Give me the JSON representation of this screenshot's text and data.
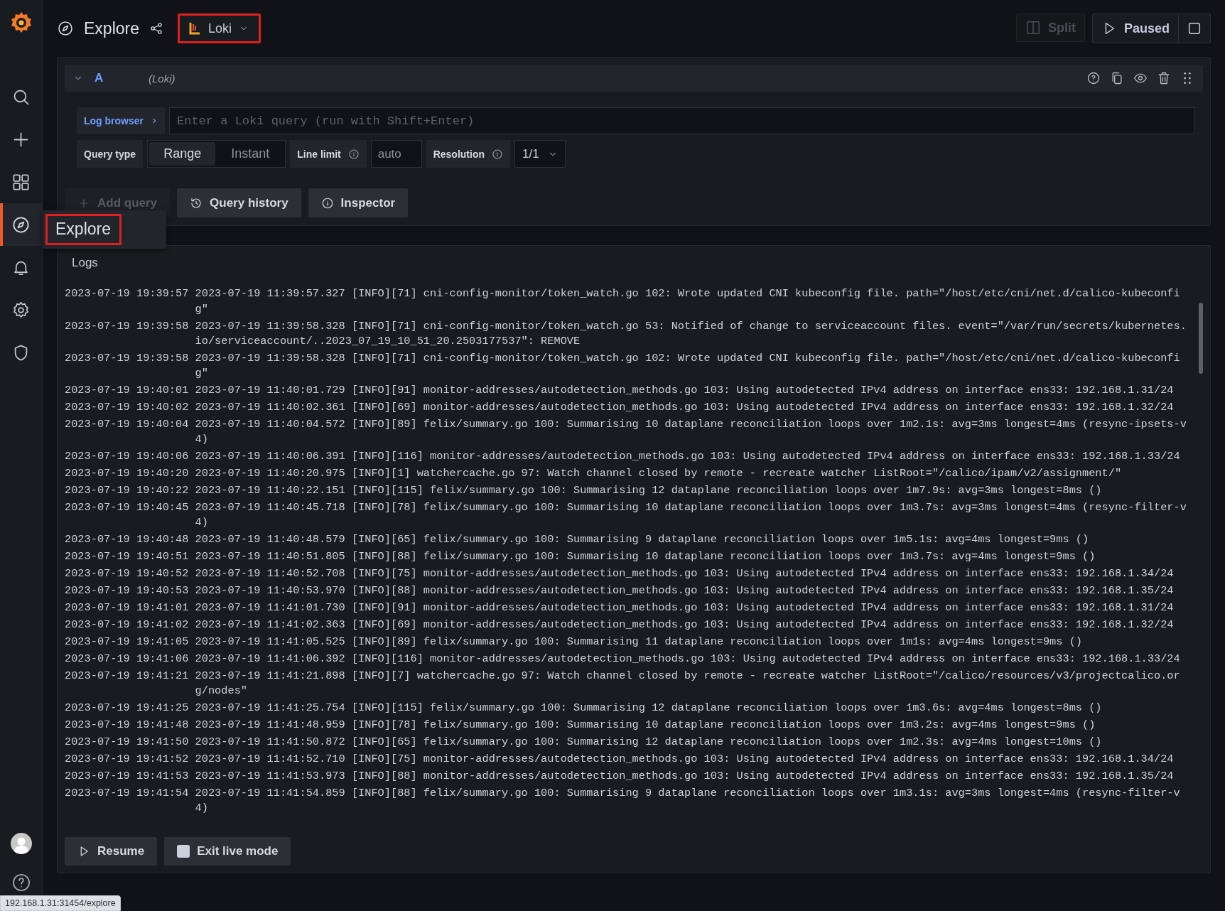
{
  "sidebar": {
    "items": [
      {
        "kind": "search",
        "selected": false
      },
      {
        "kind": "create",
        "selected": false
      },
      {
        "kind": "dashboards",
        "selected": false
      },
      {
        "kind": "explore",
        "selected": true
      },
      {
        "kind": "alerting",
        "selected": false
      },
      {
        "kind": "configuration",
        "selected": false
      },
      {
        "kind": "admin",
        "selected": false
      }
    ],
    "tooltip": "Explore"
  },
  "header": {
    "title": "Explore",
    "datasource": "Loki",
    "split": "Split",
    "live": "Paused"
  },
  "query": {
    "ref": "A",
    "datasource": "(Loki)",
    "log_browser": "Log browser",
    "placeholder": "Enter a Loki query (run with Shift+Enter)",
    "query_type_label": "Query type",
    "query_types": [
      {
        "label": "Range",
        "selected": true
      },
      {
        "label": "Instant",
        "selected": false
      }
    ],
    "line_limit_label": "Line limit",
    "line_limit_placeholder": "auto",
    "resolution_label": "Resolution",
    "resolution": "1/1"
  },
  "actions": [
    {
      "kind": "add",
      "label": "Add query",
      "disabled": true
    },
    {
      "kind": "history",
      "label": "Query history",
      "disabled": false
    },
    {
      "kind": "inspector",
      "label": "Inspector",
      "disabled": false
    }
  ],
  "logs": {
    "title": "Logs",
    "rows": [
      {
        "time": "2023-07-19 19:39:57",
        "line": "2023-07-19 11:39:57.327 [INFO][71] cni-config-monitor/token_watch.go 102: Wrote updated CNI kubeconfig file. path=\"/host/etc/cni/net.d/calico-kubeconfig\""
      },
      {
        "time": "2023-07-19 19:39:58",
        "line": "2023-07-19 11:39:58.328 [INFO][71] cni-config-monitor/token_watch.go 53: Notified of change to serviceaccount files. event=\"/var/run/secrets/kubernetes.io/serviceaccount/..2023_07_19_10_51_20.2503177537\": REMOVE"
      },
      {
        "time": "2023-07-19 19:39:58",
        "line": "2023-07-19 11:39:58.328 [INFO][71] cni-config-monitor/token_watch.go 102: Wrote updated CNI kubeconfig file. path=\"/host/etc/cni/net.d/calico-kubeconfig\""
      },
      {
        "time": "2023-07-19 19:40:01",
        "line": "2023-07-19 11:40:01.729 [INFO][91] monitor-addresses/autodetection_methods.go 103: Using autodetected IPv4 address on interface ens33: 192.168.1.31/24"
      },
      {
        "time": "2023-07-19 19:40:02",
        "line": "2023-07-19 11:40:02.361 [INFO][69] monitor-addresses/autodetection_methods.go 103: Using autodetected IPv4 address on interface ens33: 192.168.1.32/24"
      },
      {
        "time": "2023-07-19 19:40:04",
        "line": "2023-07-19 11:40:04.572 [INFO][89] felix/summary.go 100: Summarising 10 dataplane reconciliation loops over 1m2.1s: avg=3ms longest=4ms (resync-ipsets-v4)"
      },
      {
        "time": "2023-07-19 19:40:06",
        "line": "2023-07-19 11:40:06.391 [INFO][116] monitor-addresses/autodetection_methods.go 103: Using autodetected IPv4 address on interface ens33: 192.168.1.33/24"
      },
      {
        "time": "2023-07-19 19:40:20",
        "line": "2023-07-19 11:40:20.975 [INFO][1] watchercache.go 97: Watch channel closed by remote - recreate watcher ListRoot=\"/calico/ipam/v2/assignment/\""
      },
      {
        "time": "2023-07-19 19:40:22",
        "line": "2023-07-19 11:40:22.151 [INFO][115] felix/summary.go 100: Summarising 12 dataplane reconciliation loops over 1m7.9s: avg=3ms longest=8ms ()"
      },
      {
        "time": "2023-07-19 19:40:45",
        "line": "2023-07-19 11:40:45.718 [INFO][78] felix/summary.go 100: Summarising 10 dataplane reconciliation loops over 1m3.7s: avg=3ms longest=4ms (resync-filter-v4)"
      },
      {
        "time": "2023-07-19 19:40:48",
        "line": "2023-07-19 11:40:48.579 [INFO][65] felix/summary.go 100: Summarising 9 dataplane reconciliation loops over 1m5.1s: avg=4ms longest=9ms ()"
      },
      {
        "time": "2023-07-19 19:40:51",
        "line": "2023-07-19 11:40:51.805 [INFO][88] felix/summary.go 100: Summarising 10 dataplane reconciliation loops over 1m3.7s: avg=4ms longest=9ms ()"
      },
      {
        "time": "2023-07-19 19:40:52",
        "line": "2023-07-19 11:40:52.708 [INFO][75] monitor-addresses/autodetection_methods.go 103: Using autodetected IPv4 address on interface ens33: 192.168.1.34/24"
      },
      {
        "time": "2023-07-19 19:40:53",
        "line": "2023-07-19 11:40:53.970 [INFO][88] monitor-addresses/autodetection_methods.go 103: Using autodetected IPv4 address on interface ens33: 192.168.1.35/24"
      },
      {
        "time": "2023-07-19 19:41:01",
        "line": "2023-07-19 11:41:01.730 [INFO][91] monitor-addresses/autodetection_methods.go 103: Using autodetected IPv4 address on interface ens33: 192.168.1.31/24"
      },
      {
        "time": "2023-07-19 19:41:02",
        "line": "2023-07-19 11:41:02.363 [INFO][69] monitor-addresses/autodetection_methods.go 103: Using autodetected IPv4 address on interface ens33: 192.168.1.32/24"
      },
      {
        "time": "2023-07-19 19:41:05",
        "line": "2023-07-19 11:41:05.525 [INFO][89] felix/summary.go 100: Summarising 11 dataplane reconciliation loops over 1m1s: avg=4ms longest=9ms ()"
      },
      {
        "time": "2023-07-19 19:41:06",
        "line": "2023-07-19 11:41:06.392 [INFO][116] monitor-addresses/autodetection_methods.go 103: Using autodetected IPv4 address on interface ens33: 192.168.1.33/24"
      },
      {
        "time": "2023-07-19 19:41:21",
        "line": "2023-07-19 11:41:21.898 [INFO][7] watchercache.go 97: Watch channel closed by remote - recreate watcher ListRoot=\"/calico/resources/v3/projectcalico.org/nodes\""
      },
      {
        "time": "2023-07-19 19:41:25",
        "line": "2023-07-19 11:41:25.754 [INFO][115] felix/summary.go 100: Summarising 12 dataplane reconciliation loops over 1m3.6s: avg=4ms longest=8ms ()"
      },
      {
        "time": "2023-07-19 19:41:48",
        "line": "2023-07-19 11:41:48.959 [INFO][78] felix/summary.go 100: Summarising 10 dataplane reconciliation loops over 1m3.2s: avg=4ms longest=9ms ()"
      },
      {
        "time": "2023-07-19 19:41:50",
        "line": "2023-07-19 11:41:50.872 [INFO][65] felix/summary.go 100: Summarising 12 dataplane reconciliation loops over 1m2.3s: avg=4ms longest=10ms ()"
      },
      {
        "time": "2023-07-19 19:41:52",
        "line": "2023-07-19 11:41:52.710 [INFO][75] monitor-addresses/autodetection_methods.go 103: Using autodetected IPv4 address on interface ens33: 192.168.1.34/24"
      },
      {
        "time": "2023-07-19 19:41:53",
        "line": "2023-07-19 11:41:53.973 [INFO][88] monitor-addresses/autodetection_methods.go 103: Using autodetected IPv4 address on interface ens33: 192.168.1.35/24"
      },
      {
        "time": "2023-07-19 19:41:54",
        "line": "2023-07-19 11:41:54.859 [INFO][88] felix/summary.go 100: Summarising 9 dataplane reconciliation loops over 1m3.1s: avg=3ms longest=4ms (resync-filter-v4)"
      }
    ],
    "buttons": [
      {
        "kind": "resume",
        "label": "Resume"
      },
      {
        "kind": "exit",
        "label": "Exit live mode"
      }
    ]
  },
  "status_url": "192.168.1.31:31454/explore"
}
